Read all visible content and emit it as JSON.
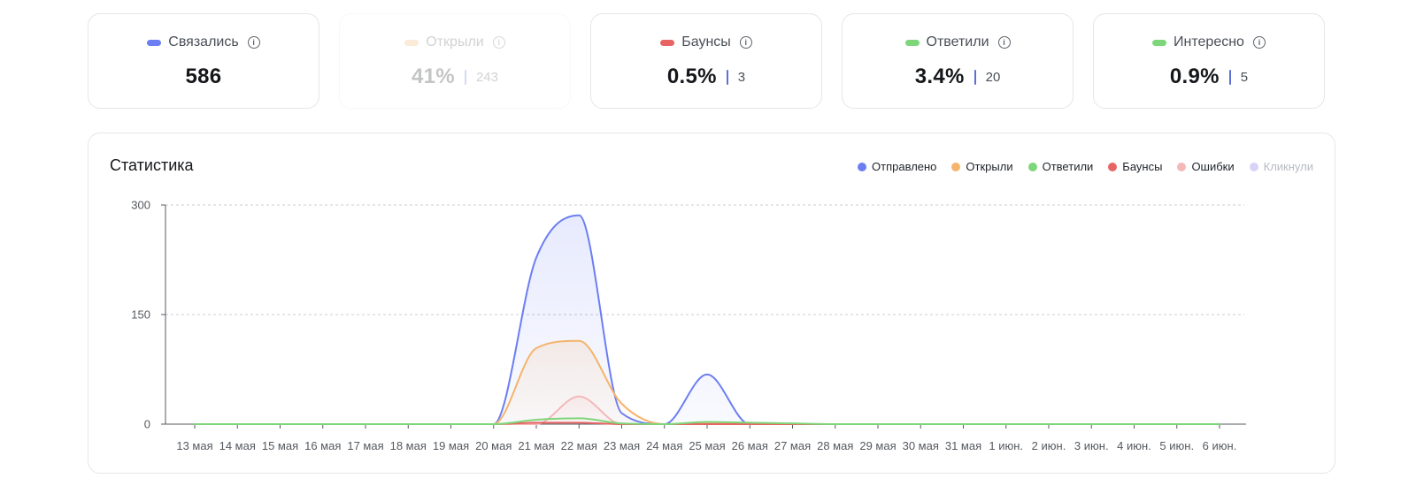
{
  "cards": [
    {
      "label": "Связались",
      "value": "586",
      "sub": "",
      "color": "#6b7ef2",
      "dim": false
    },
    {
      "label": "Открыли",
      "value": "41%",
      "sub": "243",
      "color": "#f5b46c",
      "dim": true
    },
    {
      "label": "Баунсы",
      "value": "0.5%",
      "sub": "3",
      "color": "#e86464",
      "dim": false
    },
    {
      "label": "Ответили",
      "value": "3.4%",
      "sub": "20",
      "color": "#7ed67a",
      "dim": false
    },
    {
      "label": "Интересно",
      "value": "0.9%",
      "sub": "5",
      "color": "#7ed67a",
      "dim": false
    }
  ],
  "info_icon": "info-icon",
  "panel": {
    "title": "Статистика"
  },
  "legend": [
    {
      "label": "Отправлено",
      "color": "#6b7ef2",
      "dim": false
    },
    {
      "label": "Открыли",
      "color": "#f5b46c",
      "dim": false
    },
    {
      "label": "Ответили",
      "color": "#7ed67a",
      "dim": false
    },
    {
      "label": "Баунсы",
      "color": "#e86464",
      "dim": false
    },
    {
      "label": "Ошибки",
      "color": "#f5b7b7",
      "dim": false
    },
    {
      "label": "Кликнули",
      "color": "#d9d2f8",
      "dim": true
    }
  ],
  "chart_data": {
    "type": "area",
    "categories": [
      "13 мая",
      "14 мая",
      "15 мая",
      "16 мая",
      "17 мая",
      "18 мая",
      "19 мая",
      "20 мая",
      "21 мая",
      "22 мая",
      "23 мая",
      "24 мая",
      "25 мая",
      "26 мая",
      "27 мая",
      "28 мая",
      "29 мая",
      "30 мая",
      "31 мая",
      "1 июн.",
      "2 июн.",
      "3 июн.",
      "4 июн.",
      "5 июн.",
      "6 июн."
    ],
    "yticks": [
      0,
      150,
      300
    ],
    "ylim": [
      0,
      300
    ],
    "grid": true,
    "legend_position": "top-right",
    "series": [
      {
        "name": "Отправлено",
        "color": "#6b7ef2",
        "fill": true,
        "values": [
          0,
          0,
          0,
          0,
          0,
          0,
          0,
          0,
          228,
          286,
          15,
          0,
          68,
          0,
          0,
          0,
          0,
          0,
          0,
          0,
          0,
          0,
          0,
          0,
          0
        ]
      },
      {
        "name": "Открыли",
        "color": "#f5b46c",
        "fill": true,
        "values": [
          0,
          0,
          0,
          0,
          0,
          0,
          0,
          0,
          104,
          114,
          28,
          0,
          2,
          2,
          0,
          0,
          0,
          0,
          0,
          0,
          0,
          0,
          0,
          0,
          0
        ]
      },
      {
        "name": "Ошибки",
        "color": "#f5b7b7",
        "fill": true,
        "values": [
          0,
          0,
          0,
          0,
          0,
          0,
          0,
          0,
          0,
          38,
          0,
          0,
          0,
          0,
          0,
          0,
          0,
          0,
          0,
          0,
          0,
          0,
          0,
          0,
          0
        ]
      },
      {
        "name": "Баунсы",
        "color": "#e86464",
        "fill": false,
        "values": [
          0,
          0,
          0,
          0,
          0,
          0,
          0,
          0,
          2,
          2,
          0,
          0,
          0,
          0,
          0,
          0,
          0,
          0,
          0,
          0,
          0,
          0,
          0,
          0,
          0
        ]
      },
      {
        "name": "Ответили",
        "color": "#7ed67a",
        "fill": false,
        "values": [
          0,
          0,
          0,
          0,
          0,
          0,
          0,
          0,
          6,
          8,
          1,
          0,
          3,
          2,
          1,
          0,
          0,
          0,
          0,
          0,
          0,
          0,
          0,
          0,
          0
        ]
      }
    ]
  }
}
